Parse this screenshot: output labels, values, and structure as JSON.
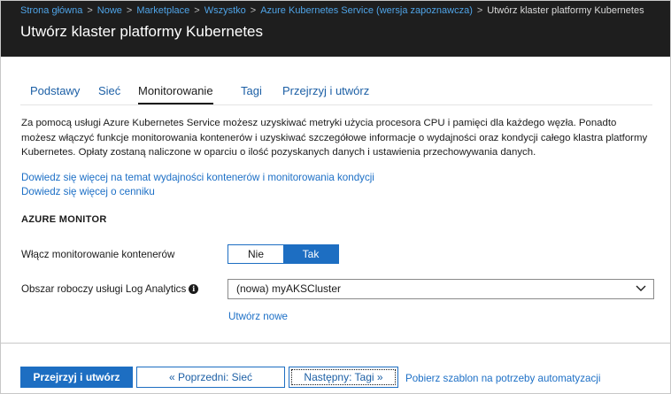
{
  "breadcrumb": {
    "items": [
      "Strona główna",
      "Nowe",
      "Marketplace",
      "Wszystko",
      "Azure Kubernetes Service (wersja zapoznawcza)"
    ],
    "current": "Utwórz klaster platformy Kubernetes",
    "separator": ">"
  },
  "header": {
    "title": "Utwórz klaster platformy Kubernetes"
  },
  "tabs": [
    {
      "label": "Podstawy",
      "active": false
    },
    {
      "label": "Sieć",
      "active": false
    },
    {
      "label": "Monitorowanie",
      "active": true
    },
    {
      "label": "Tagi",
      "active": false
    },
    {
      "label": "Przejrzyj i utwórz",
      "active": false
    }
  ],
  "description": "Za pomocą usługi Azure Kubernetes Service możesz uzyskiwać metryki użycia procesora CPU i pamięci dla każdego węzła. Ponadto możesz włączyć funkcje monitorowania kontenerów i uzyskiwać szczegółowe informacje o wydajności oraz kondycji całego klastra platformy Kubernetes. Opłaty zostaną naliczone w oparciu o ilość pozyskanych danych i ustawienia przechowywania danych.",
  "links": {
    "learn_monitoring": "Dowiedz się więcej na temat wydajności kontenerów i monitorowania kondycji",
    "learn_pricing": "Dowiedz się więcej o cenniku"
  },
  "azure_monitor": {
    "section_title": "AZURE MONITOR",
    "enable_label": "Włącz monitorowanie kontenerów",
    "toggle": {
      "off": "Nie",
      "on": "Tak",
      "selected": "Tak"
    },
    "workspace_label": "Obszar roboczy usługi Log Analytics",
    "workspace_info_icon": "info-icon",
    "workspace_value": "(nowa) myAKSCluster",
    "create_new": "Utwórz nowe"
  },
  "footer": {
    "review_create": "Przejrzyj i utwórz",
    "previous": "« Poprzedni: Sieć",
    "next": "Następny: Tagi »",
    "download_template": "Pobierz szablon na potrzeby automatyzacji"
  },
  "colors": {
    "header_bg": "#1e1e1e",
    "accent": "#1d6ec2",
    "link": "#1c6fc6",
    "breadcrumb_link": "#4fa3e6"
  }
}
